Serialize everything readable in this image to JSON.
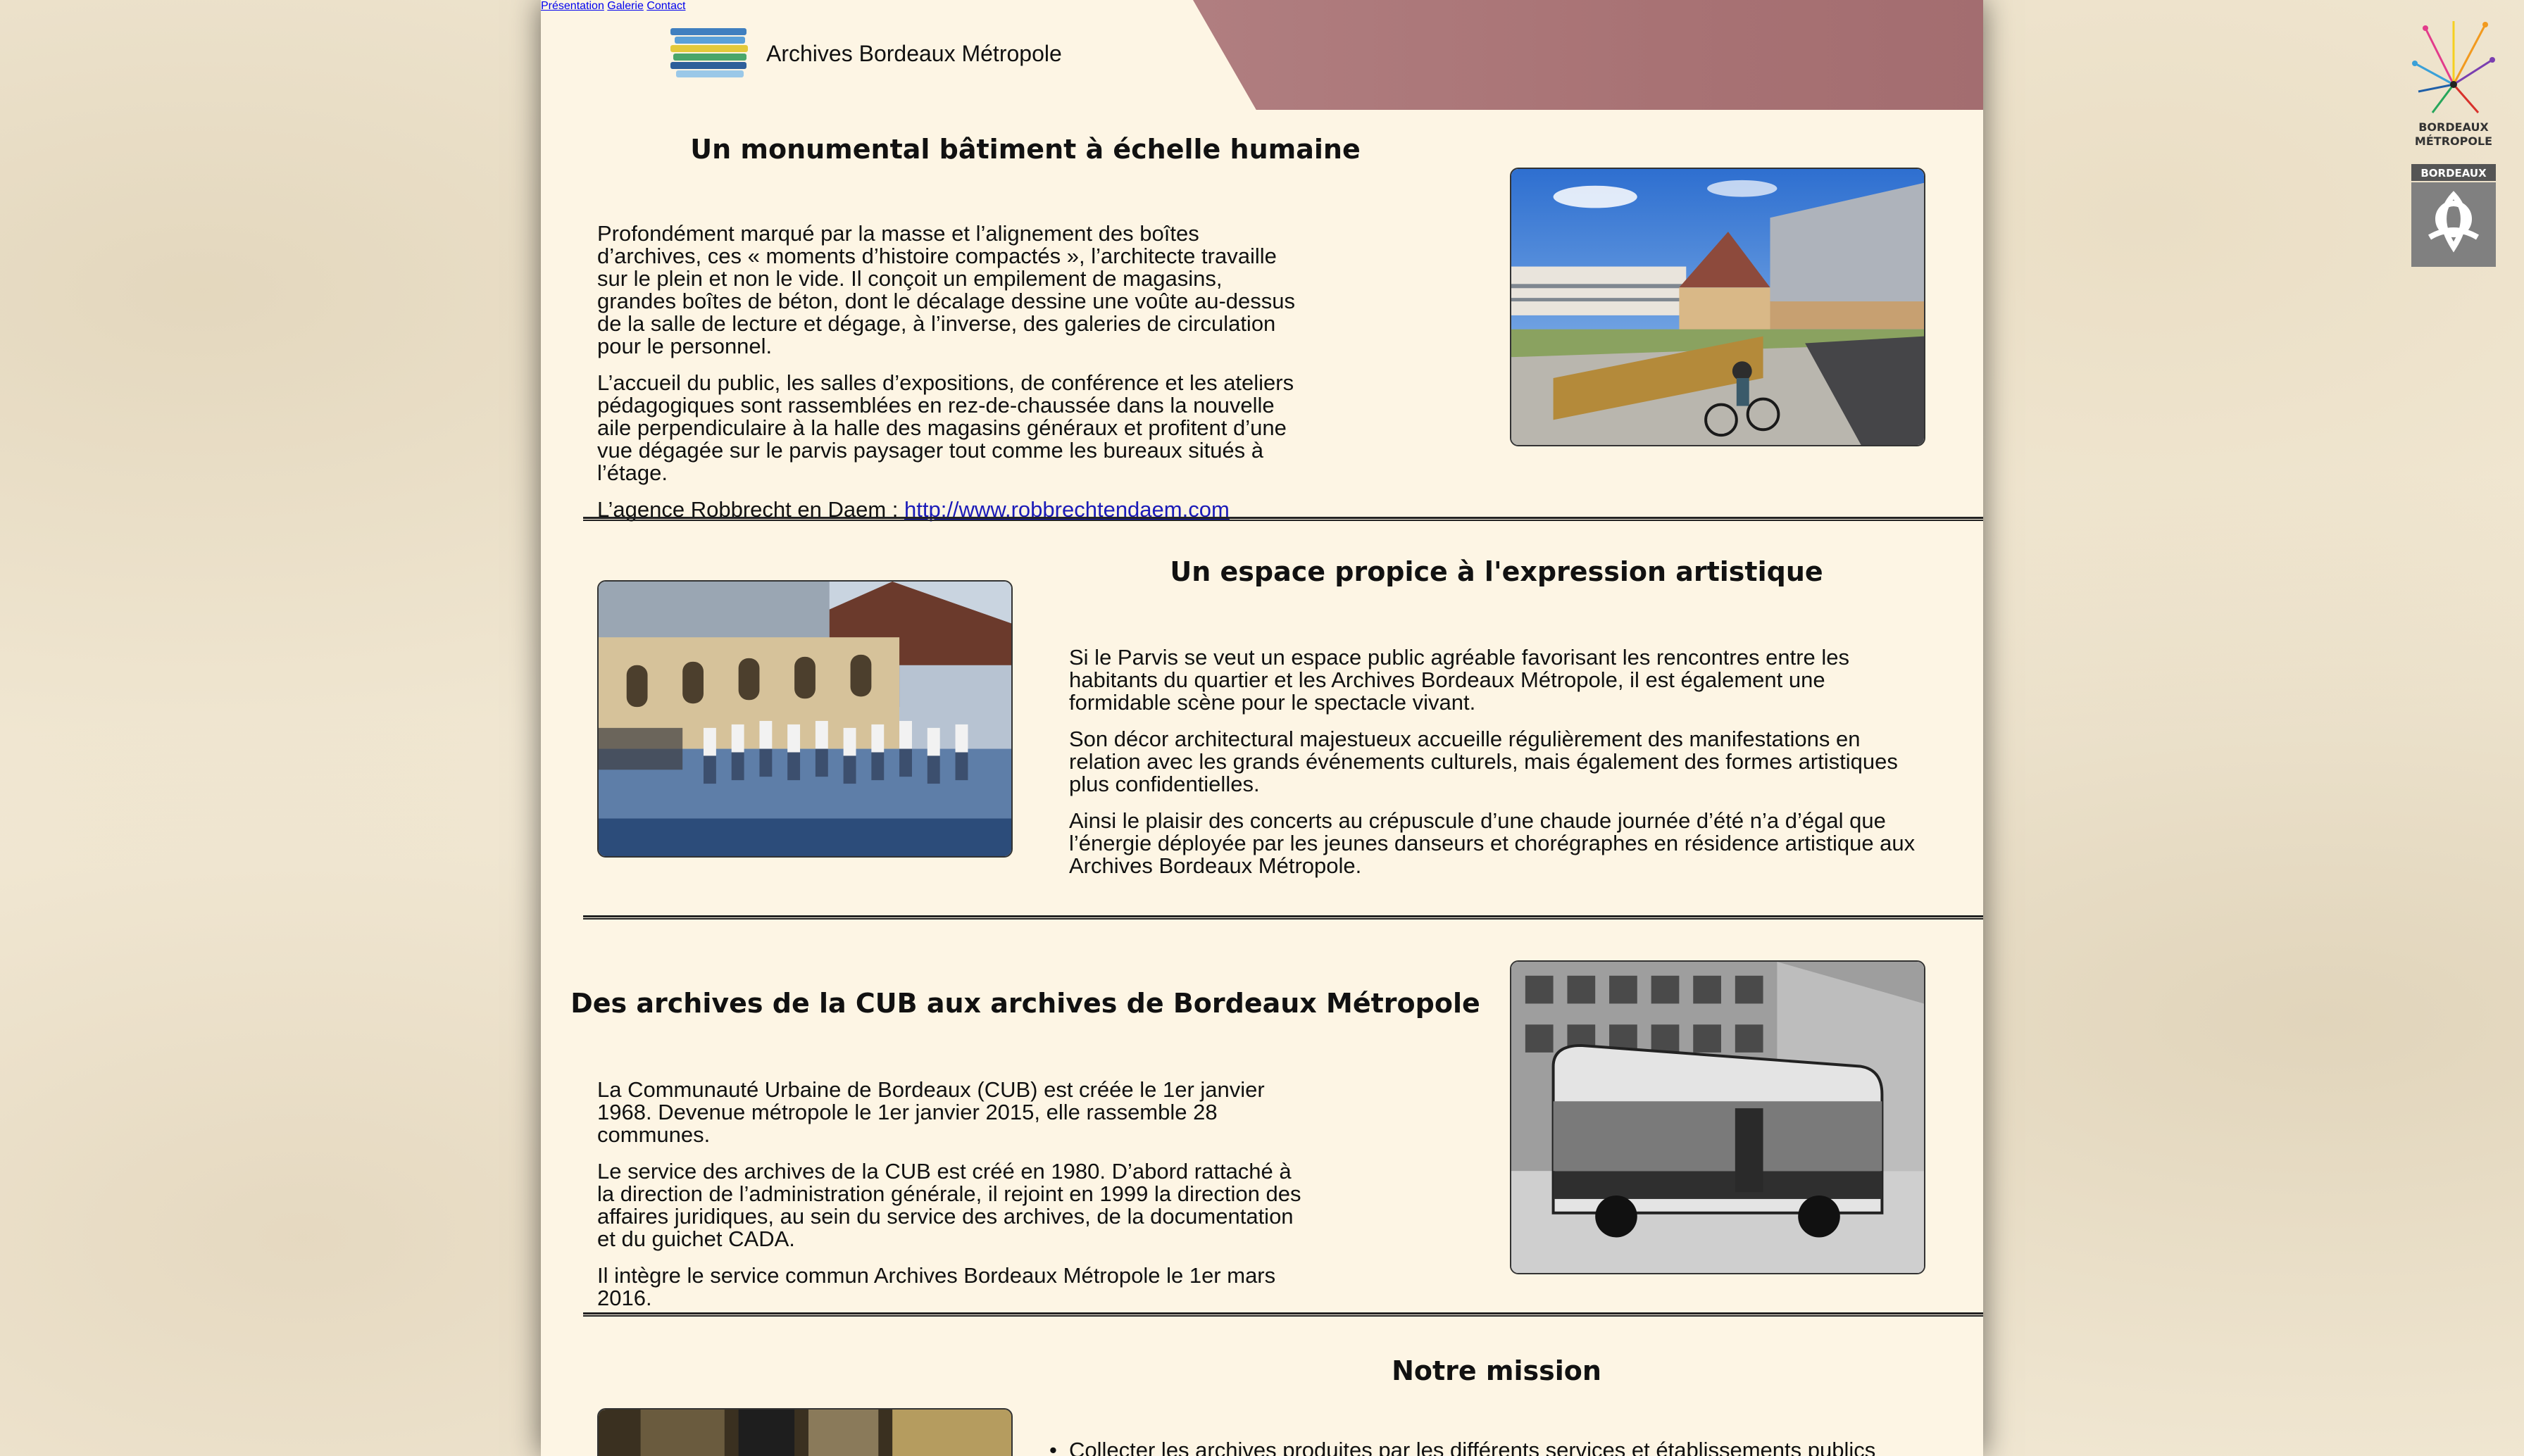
{
  "header": {
    "brand": "Archives Bordeaux Métropole",
    "nav": [
      "Présentation",
      "Galerie",
      "Contact"
    ]
  },
  "sections": [
    {
      "title": "Un monumental bâtiment à échelle humaine",
      "paragraphs": [
        "Profondément marqué par la masse et l’alignement des boîtes d’archives, ces « moments d’histoire compactés », l’architecte travaille sur le plein et non le vide. Il conçoit un empilement de magasins, grandes boîtes de béton, dont le décalage dessine une voûte au-dessus de la salle de lecture et dégage, à l’inverse, des galeries de circulation pour le personnel.",
        "L’accueil du public, les salles d’expositions, de conférence et les ateliers pédagogiques sont rassemblées en rez-de-chaussée dans la nouvelle aile perpendiculaire à la halle des magasins généraux et profitent d’une vue dégagée sur le parvis paysager tout comme les bureaux situés à l’étage."
      ],
      "link_prefix": "L’agence Robbrecht en Daem : ",
      "link_text": "http://www.robbrechtendaem.com"
    },
    {
      "title": "Un espace propice à l'expression artistique",
      "paragraphs": [
        "Si le Parvis se veut un espace public agréable favorisant les rencontres entre les habitants du quartier et les Archives Bordeaux Métropole, il est également une formidable scène pour le spectacle vivant.",
        "Son décor architectural majestueux accueille régulièrement des manifestations en relation avec les grands événements culturels, mais également des formes artistiques plus confidentielles.",
        "Ainsi le plaisir des concerts au crépuscule d’une chaude journée d’été n’a d’égal que l’énergie déployée par les jeunes danseurs et chorégraphes en résidence artistique aux Archives Bordeaux Métropole."
      ]
    },
    {
      "title": "Des archives de la CUB aux archives de Bordeaux Métropole",
      "paragraphs": [
        "La Communauté Urbaine de Bordeaux (CUB) est créée le 1er janvier 1968. Devenue métropole le 1er janvier 2015, elle rassemble 28 communes.",
        "Le service des archives de la CUB est créé en 1980. D’abord rattaché à la direction de l’administration générale, il rejoint en 1999 la direction des affaires juridiques, au sein du service des archives, de la documentation et du guichet CADA.",
        "Il intègre le service commun Archives Bordeaux Métropole le 1er mars 2016."
      ]
    },
    {
      "title": "Notre mission",
      "items": [
        "Collecter les archives produites par les différents services et établissements publics"
      ]
    }
  ],
  "side_logos": {
    "metro_line1": "BORDEAUX",
    "metro_line2": "MÉTROPOLE",
    "city": "BORDEAUX"
  },
  "colors": {
    "nav_band": "#a87274",
    "page_bg": "#fdf5e4",
    "link": "#1a1ab8"
  }
}
